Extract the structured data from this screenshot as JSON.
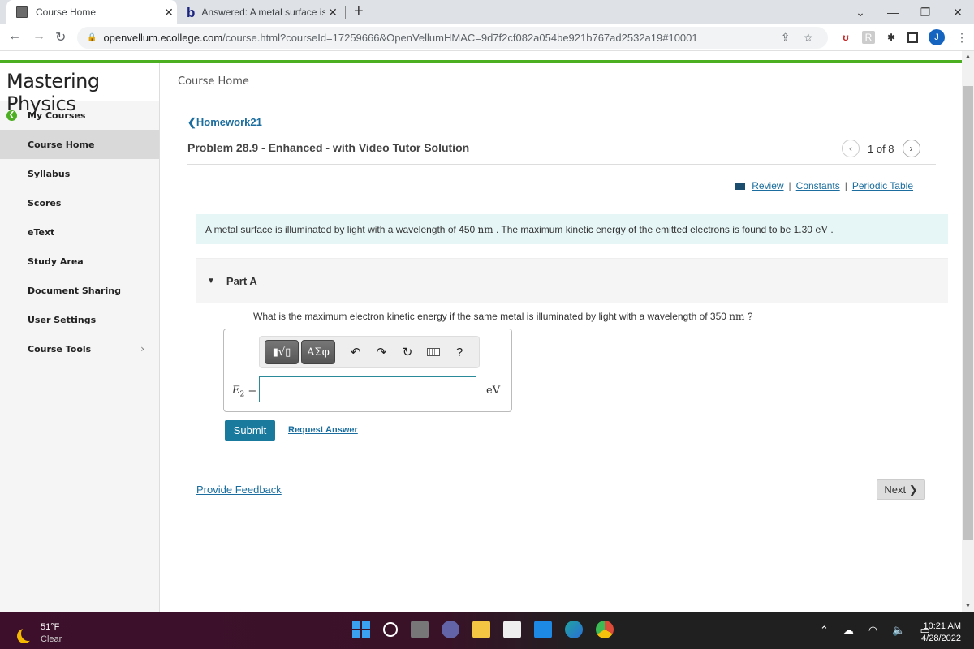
{
  "browser": {
    "tabs": [
      {
        "title": "Course Home",
        "favicon": "book-icon",
        "active": true
      },
      {
        "title": "Answered: A metal surface is illum",
        "favicon": "bartleby-b-icon",
        "active": false
      }
    ],
    "new_tab": "+",
    "close_glyph": "✕",
    "url_domain": "openvellum.ecollege.com",
    "url_path": "/course.html?courseId=17259666&OpenVellumHMAC=9d7f2cf082a054be921b767ad2532a19#10001",
    "profile_initial": "J"
  },
  "sidebar": {
    "brand": "Mastering Physics",
    "items": [
      {
        "label": "My Courses",
        "icon": "back-arrow-icon"
      },
      {
        "label": "Course Home",
        "active": true
      },
      {
        "label": "Syllabus"
      },
      {
        "label": "Scores"
      },
      {
        "label": "eText"
      },
      {
        "label": "Study Area"
      },
      {
        "label": "Document Sharing"
      },
      {
        "label": "User Settings"
      },
      {
        "label": "Course Tools",
        "has_submenu": true
      }
    ]
  },
  "main": {
    "breadcrumb": "Course Home",
    "back_link": "Homework21",
    "problem_title": "Problem 28.9 - Enhanced - with Video Tutor Solution",
    "pager": {
      "label": "1 of 8",
      "current": 1,
      "total": 8
    },
    "resources": {
      "review": "Review",
      "constants": "Constants",
      "periodic_table": "Periodic Table",
      "separator": "|"
    },
    "prompt": {
      "text1": "A metal surface is illuminated by light with a wavelength of 450 ",
      "unit1": "nm",
      "text2": " . The maximum kinetic energy of the emitted electrons is found to be 1.30 ",
      "unit2": "eV",
      "text3": " ."
    },
    "part": {
      "label": "Part A",
      "expanded": true
    },
    "question": {
      "text1": "What is the maximum electron kinetic energy if the same metal is illuminated by light with a wavelength of 350 ",
      "unit": "nm",
      "text2": " ?"
    },
    "answer": {
      "toolbar": {
        "templates": "▮√▯",
        "greek": "ΑΣφ",
        "undo": "↶",
        "redo": "↷",
        "reset": "↻",
        "help": "?"
      },
      "variable": "E",
      "subscript": "2",
      "equals": " =",
      "value": "",
      "unit": "eV"
    },
    "submit_label": "Submit",
    "request_answer_label": "Request Answer",
    "feedback_label": "Provide Feedback",
    "next_label": "Next ❯"
  },
  "taskbar": {
    "weather": {
      "temp": "51°F",
      "condition": "Clear"
    },
    "apps": [
      {
        "name": "windows-start",
        "color": "#2a9df4"
      },
      {
        "name": "search",
        "color": "transparent"
      },
      {
        "name": "task-view",
        "color": "#666666"
      },
      {
        "name": "teams-chat",
        "color": "#6264a7"
      },
      {
        "name": "file-explorer",
        "color": "#f4c542"
      },
      {
        "name": "microsoft-store",
        "color": "#e8e8e8"
      },
      {
        "name": "mail",
        "color": "#1e88e5"
      },
      {
        "name": "edge",
        "color": "#1fa3a0"
      },
      {
        "name": "chrome",
        "color": "#dd4b39"
      }
    ],
    "time": "10:21 AM",
    "date": "4/28/2022"
  }
}
